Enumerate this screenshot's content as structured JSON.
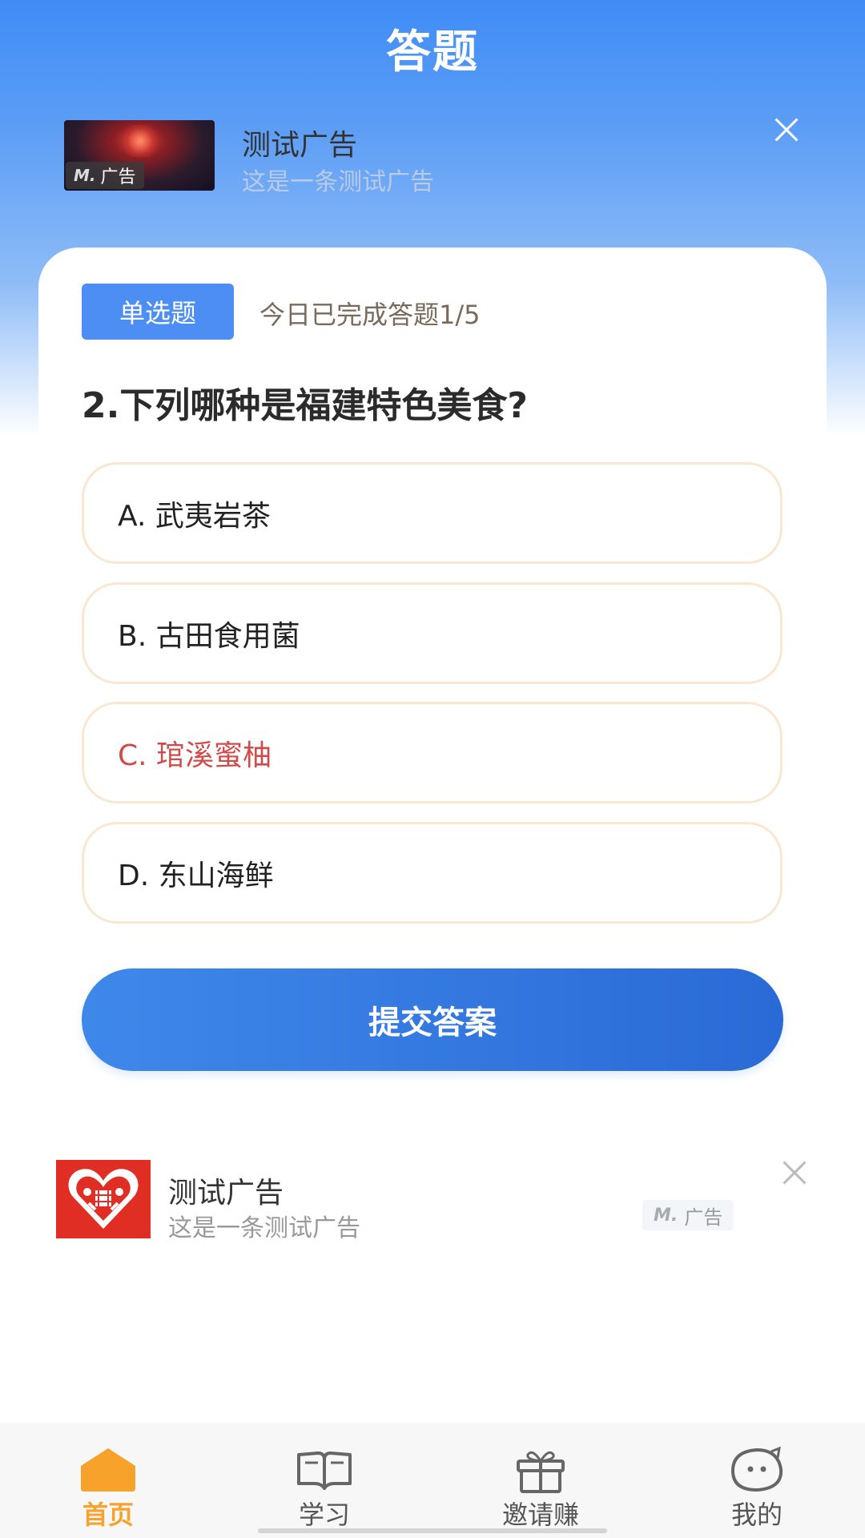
{
  "header": {
    "title": "答题"
  },
  "top_ad": {
    "title": "测试广告",
    "subtitle": "这是一条测试广告",
    "tag": "广告",
    "mark": "M."
  },
  "quiz": {
    "type_label": "单选题",
    "progress_text": "今日已完成答题1/5",
    "question": "2.下列哪种是福建特色美食?",
    "options": [
      {
        "label": "A. 武夷岩茶"
      },
      {
        "label": "B. 古田食用菌"
      },
      {
        "label": "C. 琯溪蜜柚"
      },
      {
        "label": "D. 东山海鲜"
      }
    ],
    "selected_option": "C",
    "submit_label": "提交答案",
    "accent_color": "#4d8ef5",
    "selected_color": "#d14b4b"
  },
  "bottom_ad": {
    "title": "测试广告",
    "subtitle": "这是一条测试广告",
    "tag": "广告",
    "mark": "M."
  },
  "tabbar": {
    "items": [
      {
        "label": "首页",
        "icon": "home-icon",
        "active": true
      },
      {
        "label": "学习",
        "icon": "book-icon",
        "active": false
      },
      {
        "label": "邀请赚",
        "icon": "gift-icon",
        "active": false
      },
      {
        "label": "我的",
        "icon": "profile-face-icon",
        "active": false
      }
    ],
    "active_color": "#f5a22e"
  }
}
